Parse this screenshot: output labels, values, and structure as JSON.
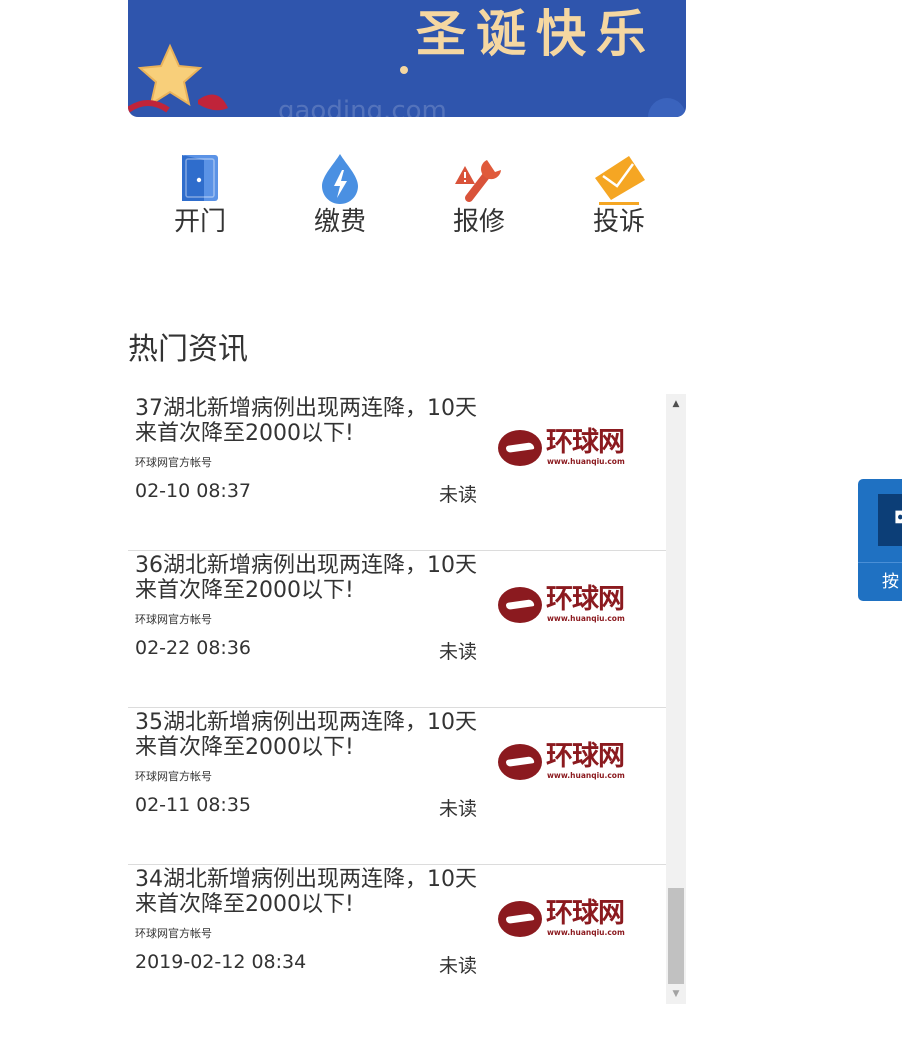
{
  "banner": {
    "title": "圣诞快乐",
    "watermark": "gaoding.com"
  },
  "actions": [
    {
      "label": "开门",
      "icon": "door-icon",
      "color": "#3f7fd8"
    },
    {
      "label": "缴费",
      "icon": "water-drop-bolt-icon",
      "color": "#4a90e2"
    },
    {
      "label": "报修",
      "icon": "wrench-icon",
      "color": "#e05a3b"
    },
    {
      "label": "投诉",
      "icon": "envelope-icon",
      "color": "#f5a623"
    }
  ],
  "section": {
    "title": "热门资讯"
  },
  "news": [
    {
      "headline": "37湖北新增病例出现两连降，10天来首次降至2000以下!",
      "source": "环球网官方帐号",
      "time": "02-10 08:37",
      "status": "未读",
      "logo_cn": "环球网",
      "logo_url": "www.huanqiu.com"
    },
    {
      "headline": "36湖北新增病例出现两连降，10天来首次降至2000以下!",
      "source": "环球网官方帐号",
      "time": "02-22 08:36",
      "status": "未读",
      "logo_cn": "环球网",
      "logo_url": "www.huanqiu.com"
    },
    {
      "headline": "35湖北新增病例出现两连降，10天来首次降至2000以下!",
      "source": "环球网官方帐号",
      "time": "02-11 08:35",
      "status": "未读",
      "logo_cn": "环球网",
      "logo_url": "www.huanqiu.com"
    },
    {
      "headline": "34湖北新增病例出现两连降，10天来首次降至2000以下!",
      "source": "环球网官方帐号",
      "time": "2019-02-12 08:34",
      "status": "未读",
      "logo_cn": "环球网",
      "logo_url": "www.huanqiu.com"
    }
  ],
  "side_tool": {
    "label": "按",
    "icon": "camera-icon"
  },
  "colors": {
    "banner_bg": "#2f55ad",
    "logo_red": "#8b1a1f",
    "side_tool_bg": "#1f71c2"
  }
}
